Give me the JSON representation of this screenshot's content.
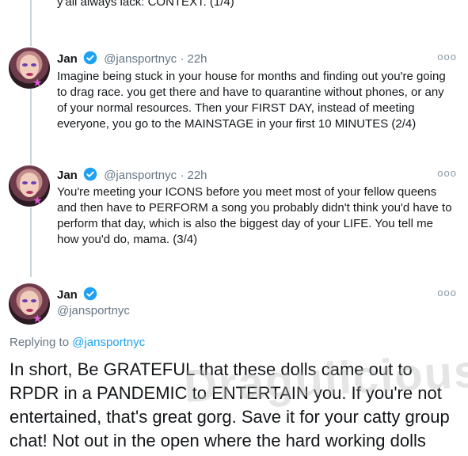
{
  "top_partial_text": "y'all always lack: CONTEXT. (1/4)",
  "tweets": [
    {
      "name": "Jan",
      "handle": "@jansportnyc",
      "separator": "·",
      "time": "22h",
      "text": "Imagine being stuck in your house for months and finding out you're going to drag race. you get there and have to quarantine without phones, or any of your normal resources. Then your FIRST DAY, instead of meeting everyone, you go to the MAINSTAGE in your first 10 MINUTES (2/4)"
    },
    {
      "name": "Jan",
      "handle": "@jansportnyc",
      "separator": "·",
      "time": "22h",
      "text": "You're meeting your ICONS before you meet most of your fellow queens and then have to PERFORM a song you probably didn't think you'd have to perform that day, which is also the biggest day of your LIFE. You tell me how you'd do, mama. (3/4)"
    }
  ],
  "main_tweet": {
    "name": "Jan",
    "handle": "@jansportnyc",
    "replying_prefix": "Replying to",
    "replying_to": "@jansportnyc",
    "text": "In short, Be GRATEFUL that these dolls came out to RPDR in a PANDEMIC to ENTERTAIN you. If you're not entertained, that's great gorg. Save it for your catty group chat! Not out in the open where the hard working dolls"
  },
  "more_icon": "more-horizontal-icon",
  "verified_icon": "verified-badge-icon",
  "colors": {
    "accent": "#1da1f2",
    "muted": "#657786",
    "line": "#ccd6dd"
  },
  "watermark": "Dragulicious"
}
